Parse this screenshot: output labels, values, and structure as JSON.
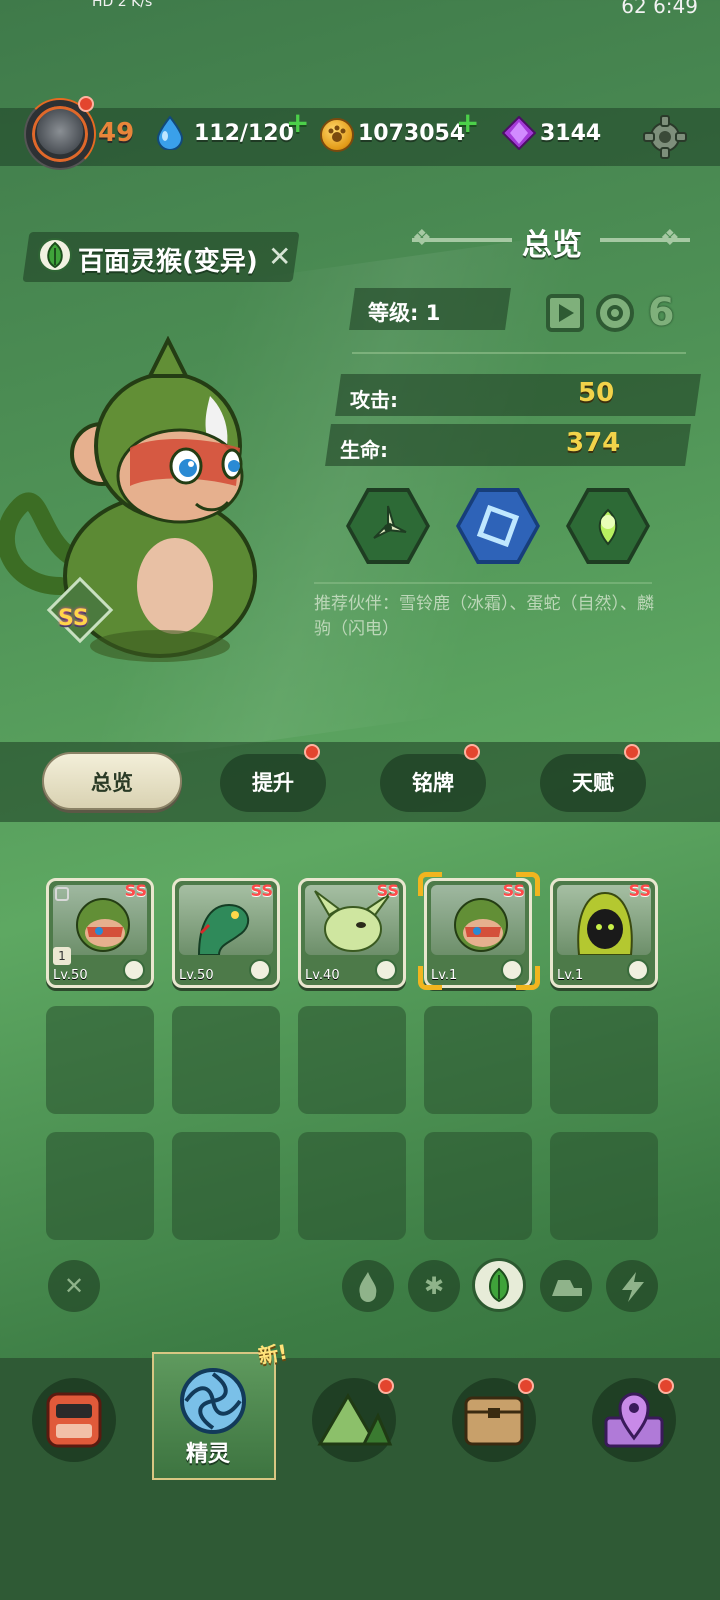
{
  "status_bar": {
    "left_text": "HD 2 K/s",
    "battery": "62",
    "time": "6:49"
  },
  "resources": {
    "player_level": "49",
    "water": "112/120",
    "coins": "1073054",
    "gems": "3144"
  },
  "pet": {
    "name": "百面灵猴(变异)",
    "rank_badge": "SS",
    "element": "leaf"
  },
  "overview": {
    "title": "总览",
    "level_label": "等级:",
    "level_value": "1",
    "attack_label": "攻击:",
    "attack_value": "50",
    "hp_label": "生命:",
    "hp_value": "374",
    "partners": "推荐伙伴：雪铃鹿（冰霜）、蛋蛇（自然）、麟驹（闪电）"
  },
  "skills": [
    {
      "icon": "shuriken-icon",
      "color": "#2d6a36"
    },
    {
      "icon": "frame-icon",
      "color": "#2e63b8"
    },
    {
      "icon": "orb-icon",
      "color": "#2d6a36"
    }
  ],
  "tabs": [
    {
      "label": "总览",
      "active": true,
      "badge": false
    },
    {
      "label": "提升",
      "active": false,
      "badge": true
    },
    {
      "label": "铭牌",
      "active": false,
      "badge": true
    },
    {
      "label": "天赋",
      "active": false,
      "badge": true
    }
  ],
  "pets": [
    {
      "rank": "SS",
      "level": "Lv.50",
      "art": "monkey",
      "locked": true,
      "slot": "1"
    },
    {
      "rank": "SS",
      "level": "Lv.50",
      "art": "snake"
    },
    {
      "rank": "SS",
      "level": "Lv.40",
      "art": "dragon"
    },
    {
      "rank": "SS",
      "level": "Lv.1",
      "art": "monkey",
      "selected": true
    },
    {
      "rank": "SS",
      "level": "Lv.1",
      "art": "hooded"
    }
  ],
  "filters": [
    "clear-icon",
    "fire-icon",
    "snowflake-icon",
    "leaf-icon",
    "rock-icon",
    "lightning-icon"
  ],
  "bottom_nav": {
    "selected_label": "精灵",
    "new_tag": "新!"
  }
}
